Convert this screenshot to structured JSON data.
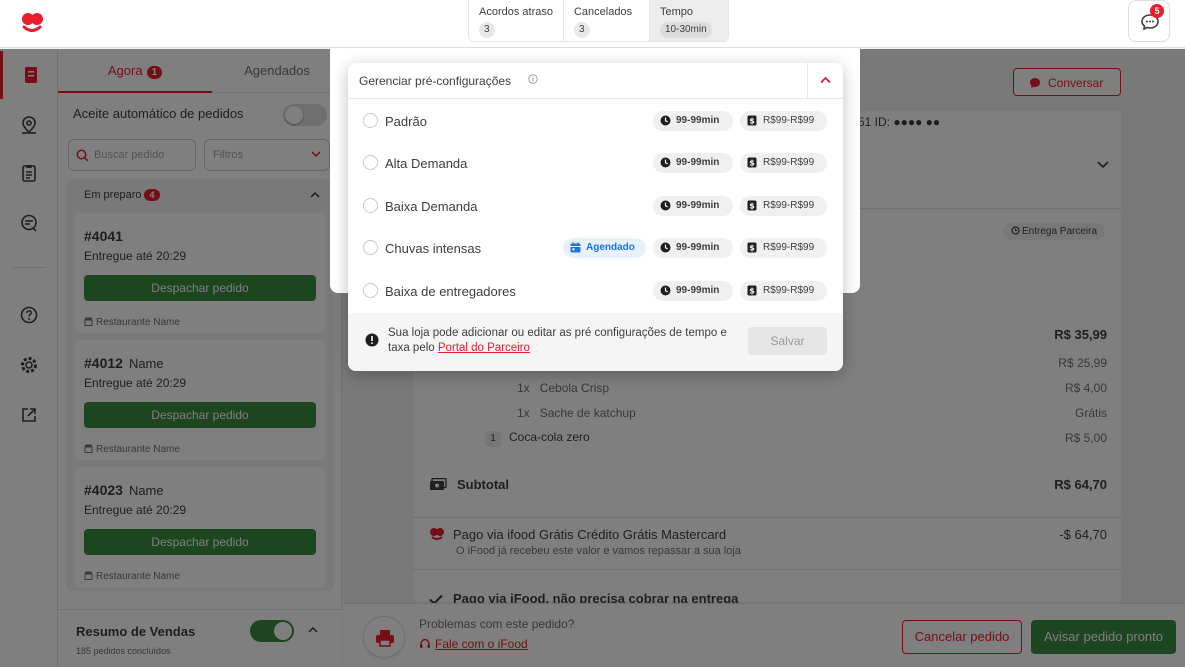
{
  "topbar": {
    "kpis": [
      {
        "label": "Acordos atraso",
        "value": "3"
      },
      {
        "label": "Cancelados",
        "value": "3"
      },
      {
        "label": "Tempo",
        "value": "10-30min"
      }
    ],
    "chat_badge": "5"
  },
  "orders": {
    "tab_now": "Agora",
    "tab_now_count": "1",
    "tab_scheduled": "Agendados",
    "auto_accept_label": "Aceite automático de pedidos",
    "search_placeholder": "Buscar pedido",
    "filters_placeholder": "Filtros",
    "group_label": "Em preparo",
    "group_count": "4",
    "cards": [
      {
        "id": "#4041",
        "name": "",
        "eta": "Entregue até 20:29",
        "action": "Despachar pedido",
        "restaurant": "Restaurante Name"
      },
      {
        "id": "#4012",
        "name": "Name",
        "eta": "Entregue até 20:29",
        "action": "Despachar pedido",
        "restaurant": "Restaurante Name"
      },
      {
        "id": "#4023",
        "name": "Name",
        "eta": "Entregue até 20:29",
        "action": "Despachar pedido",
        "restaurant": "Restaurante Name"
      }
    ],
    "sales_title": "Resumo de Vendas",
    "sales_subtitle": "185 pedidos concluídos"
  },
  "detail": {
    "chat_button": "Conversar",
    "id_line": "51 ID: ●●●● ●●",
    "delivery_badge": "Entrega Parceira",
    "top_price": "R$ 35,99",
    "items_sub_price": "R$ 25,99",
    "items": [
      {
        "qty": "1x",
        "name": "Cebola Crisp",
        "price": "R$ 4,00"
      },
      {
        "qty": "1x",
        "name": "Sache de katchup",
        "price": "Grátis"
      }
    ],
    "item_main": {
      "qty": "1",
      "name": "Coca-cola zero",
      "price": "R$ 5,00"
    },
    "subtotal_label": "Subtotal",
    "subtotal_value": "R$ 64,70",
    "payment_label": "Pago via ifood Grátis Crédito Grátis Mastercard",
    "payment_sub": "O iFood já recebeu este valor e vamos repassar a sua loja",
    "payment_value": "-$ 64,70",
    "paid_note": "Pago via iFood, não precisa cobrar na entrega",
    "problems_label": "Problemas com este pedido?",
    "contact_link": "Fale com o iFood",
    "cancel_button": "Cancelar pedido",
    "ready_button": "Avisar pedido pronto"
  },
  "modal": {
    "title": "Gerenciar pré-configurações",
    "options": [
      {
        "label": "Padrão",
        "time": "99-99min",
        "fee": "R$99-R$99",
        "tag": ""
      },
      {
        "label": "Alta Demanda",
        "time": "99-99min",
        "fee": "R$99-R$99",
        "tag": ""
      },
      {
        "label": "Baixa Demanda",
        "time": "99-99min",
        "fee": "R$99-R$99",
        "tag": ""
      },
      {
        "label": "Chuvas intensas",
        "time": "99-99min",
        "fee": "R$99-R$99",
        "tag": "Agendado"
      },
      {
        "label": "Baixa de entregadores",
        "time": "99-99min",
        "fee": "R$99-R$99",
        "tag": ""
      }
    ],
    "notice_text": "Sua loja pode adicionar ou editar as pré configurações de tempo e taxa pelo ",
    "notice_link": "Portal do Parceiro",
    "save_button": "Salvar"
  },
  "colors": {
    "brand": "#ea1d2c",
    "success": "#3a8a3f",
    "info": "#1a73e8"
  }
}
